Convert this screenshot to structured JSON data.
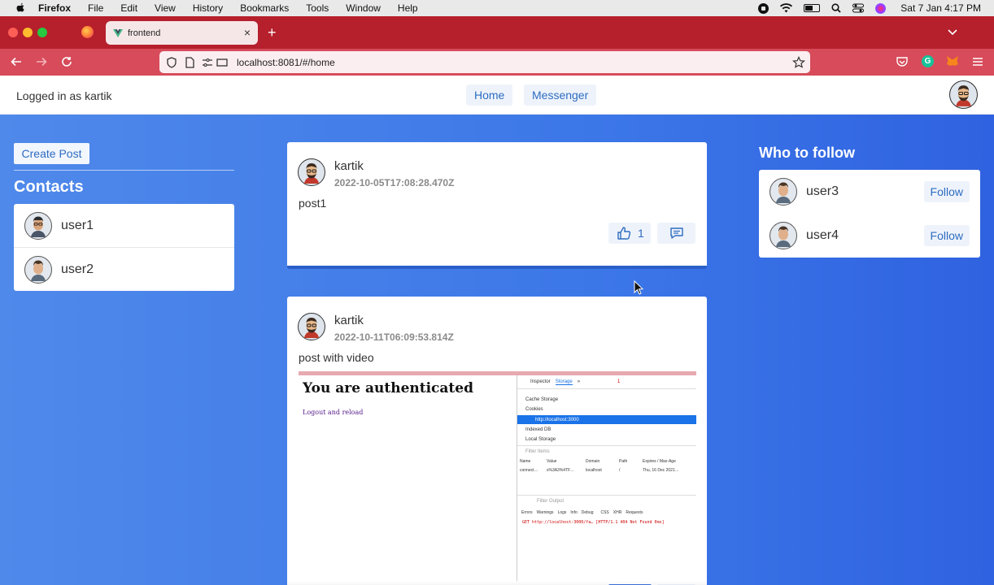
{
  "menubar": {
    "app": "Firefox",
    "items": [
      "File",
      "Edit",
      "View",
      "History",
      "Bookmarks",
      "Tools",
      "Window",
      "Help"
    ],
    "clock": "Sat 7 Jan  4:17 PM"
  },
  "browser": {
    "tab_title": "frontend",
    "new_tab": "+",
    "tab_close": "×",
    "url": "localhost:8081/#/home",
    "grammarly_glyph": "G"
  },
  "header": {
    "logged_in": "Logged in as kartik",
    "nav": [
      "Home",
      "Messenger"
    ]
  },
  "sidebar": {
    "create_post": "Create Post",
    "contacts_title": "Contacts",
    "contacts": [
      "user1",
      "user2"
    ]
  },
  "feed": {
    "posts": [
      {
        "author": "kartik",
        "date": "2022-10-05T17:08:28.470Z",
        "body": "post1",
        "likes": "1"
      },
      {
        "author": "kartik",
        "date": "2022-10-11T06:09:53.814Z",
        "body": "post with video"
      }
    ],
    "video": {
      "heading": "You are authenticated",
      "link": "Logout and reload",
      "devtools": {
        "tabs": [
          "Inspector",
          "Storage",
          "»"
        ],
        "error_badge": "1",
        "tree": [
          "Cache Storage",
          "Cookies",
          "http://localhost:3000",
          "Indexed DB",
          "Local Storage"
        ],
        "filter_items": "Filter Items",
        "columns": [
          "Name",
          "Value",
          "Domain",
          "Path",
          "Expires / Max-Age"
        ],
        "cookie_row": [
          "connect…",
          "s%3A3%4TF…",
          "localhost",
          "/",
          "Thu, 16 Dec 2021…"
        ],
        "filter_output": "Filter Output",
        "console_tabs": [
          "Errors",
          "Warnings",
          "Logs",
          "Info",
          "Debug",
          "CSS",
          "XHR",
          "Requests"
        ],
        "console_error": "GET http://localhost:3000/fa…  [HTTP/1.1 404 Not Found 0ms]"
      }
    }
  },
  "who_to_follow": {
    "title": "Who to follow",
    "users": [
      {
        "name": "user3",
        "action": "Follow"
      },
      {
        "name": "user4",
        "action": "Follow"
      }
    ]
  }
}
